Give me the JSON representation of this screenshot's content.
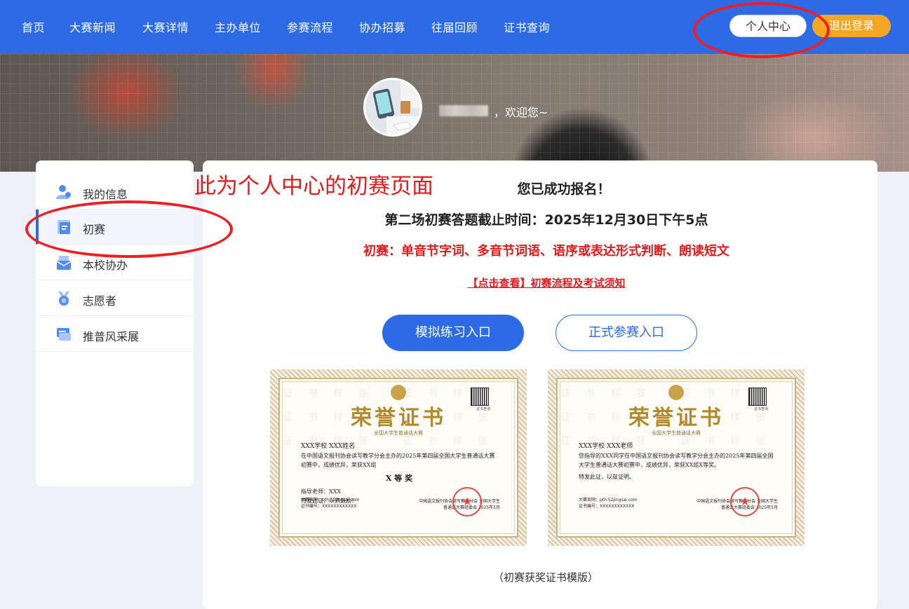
{
  "nav": {
    "items": [
      "首页",
      "大赛新闻",
      "大赛详情",
      "主办单位",
      "参赛流程",
      "协办招募",
      "往届回顾",
      "证书查询"
    ],
    "personal_center": "个人中心",
    "logout": "退出登录"
  },
  "banner": {
    "welcome": "，欢迎您~"
  },
  "sidebar": {
    "items": [
      {
        "label": "我的信息",
        "icon": "user-icon"
      },
      {
        "label": "初赛",
        "icon": "document-icon",
        "active": true
      },
      {
        "label": "本校协办",
        "icon": "mail-icon"
      },
      {
        "label": "志愿者",
        "icon": "medal-icon"
      },
      {
        "label": "推普风采展",
        "icon": "chat-icon"
      }
    ]
  },
  "annotation": {
    "text": "此为个人中心的初赛页面",
    "color": "#e6191c"
  },
  "main": {
    "success": "您已成功报名！",
    "deadline": "第二场初赛答题截止时间：2025年12月30日下午5点",
    "content": "初赛：单音节字词、多音节词语、语序或表达形式判断、朗读短文",
    "link": "【点击查看】初赛流程及考试须知",
    "mock_button": "模拟练习入口",
    "formal_button": "正式参赛入口",
    "caption": "（初赛获奖证书模版）"
  },
  "certificates": [
    {
      "title": "荣誉证书",
      "subtitle": "全国大学生普通话大赛",
      "watermark": "证书样张",
      "qr_label": "证书查询",
      "recipient": "XXX学校 XXX姓名",
      "body": "在中国语文报刊协会读写教学分会主办的2025年第四届全国大学生普通话大赛初赛中，成绩优异，荣获XX组",
      "grade": "X 等 奖",
      "teacher": "指导老师：XXX",
      "closing": "特发此证，以资鼓励！",
      "site": "大赛官网：pth.52jingsai.com",
      "cert_no": "证书编号：XXXXXXXXXXXX",
      "issuer": "中国语文报刊协会读写教学分会 全国大学生普通话大赛组委会 2025年5月"
    },
    {
      "title": "荣誉证书",
      "subtitle": "全国大学生普通话大赛",
      "watermark": "证书样张",
      "qr_label": "证书查询",
      "recipient": "XXX学校 XXX老师",
      "body": "您指导的XXX同学在中国语文报刊协会读写教学分会主办的2025年第四届全国大学生普通话大赛初赛中，成绩优异，荣获XX组X等奖。",
      "grade": "",
      "teacher": "特发此证，以兹证明。",
      "closing": "",
      "site": "大赛官网：pth.52jingsai.com",
      "cert_no": "证书编号：XXXXXXXXXXXX",
      "issuer": "中国语文报刊协会读写教学分会 全国大学生普通话大赛组委会 2025年5月"
    }
  ],
  "colors": {
    "primary": "#2d6be6",
    "logout": "#f5a623",
    "alert_red": "#e6191c"
  }
}
